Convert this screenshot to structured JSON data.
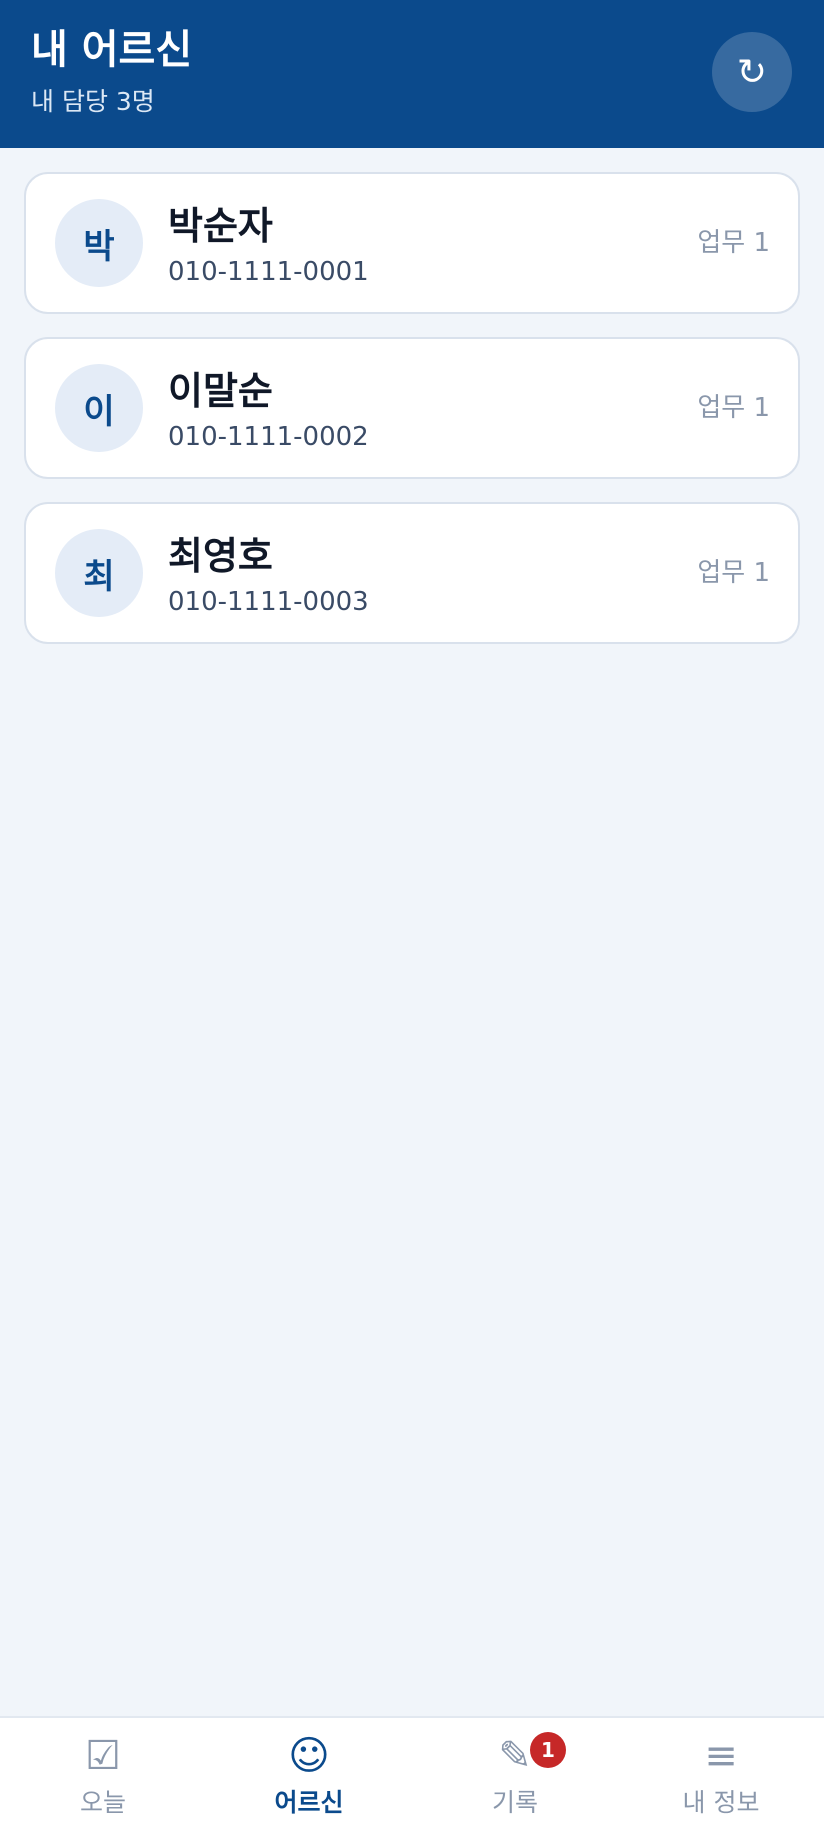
{
  "header": {
    "title": "내 어르신",
    "subtitle": "내 담당 3명",
    "refresh_icon": "↻"
  },
  "seniors": [
    {
      "initial": "박",
      "name": "박순자",
      "phone": "010-1111-0001",
      "tasks": "업무 1"
    },
    {
      "initial": "이",
      "name": "이말순",
      "phone": "010-1111-0002",
      "tasks": "업무 1"
    },
    {
      "initial": "최",
      "name": "최영호",
      "phone": "010-1111-0003",
      "tasks": "업무 1"
    }
  ],
  "nav": {
    "items": [
      {
        "label": "오늘",
        "icon": "☑",
        "icon_name": "checkbox-icon"
      },
      {
        "label": "어르신",
        "icon": "☺",
        "icon_name": "smiley-icon"
      },
      {
        "label": "기록",
        "icon": "✎",
        "icon_name": "pencil-icon",
        "badge": "1"
      },
      {
        "label": "내 정보",
        "icon": "≡",
        "icon_name": "menu-icon"
      }
    ],
    "active_index": 1
  },
  "colors": {
    "primary": "#0b4a8c",
    "background": "#f1f5fa",
    "badge": "#c62828",
    "muted": "#8a97ab"
  }
}
